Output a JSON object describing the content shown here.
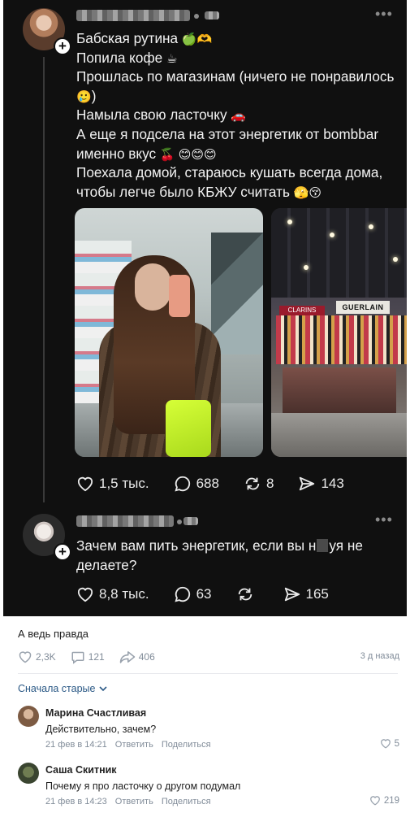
{
  "post": {
    "lines": [
      "Бабская рутина",
      "Попила кофе",
      "Прошлась по магазинам (ничего не понравилось",
      ")",
      "Намыла свою ласточку",
      "А еще я подсела на этот энергетик от bombbar",
      "именно вкус",
      "Поехала домой, стараюсь кушать всегда дома,",
      "чтобы легче было КБЖУ считать"
    ],
    "emoji": {
      "line1": "🍏🫶",
      "line2": "☕",
      "line3": "🥲",
      "line5": "🚗",
      "line7": "🍒 😊😊😊",
      "line9": "🫣😚"
    },
    "photo2_sign_left": "CLARINS",
    "photo2_sign_right": "GUERLAIN",
    "actions": {
      "likes": "1,5 тыс.",
      "comments": "688",
      "reposts": "8",
      "shares": "143"
    }
  },
  "reply": {
    "text_before": "Зачем вам пить энергетик, если вы н",
    "text_after": "уя не",
    "line2": "делаете?",
    "actions": {
      "likes": "8,8 тыс.",
      "comments": "63",
      "reposts": "",
      "shares": "165"
    }
  },
  "caption": "А ведь правда",
  "stats": {
    "likes": "2,3K",
    "comments": "121",
    "shares": "406",
    "time": "3 д назад"
  },
  "sort_label": "Сначала старые",
  "comments": [
    {
      "name": "Марина Счастливая",
      "text": "Действительно, зачем?",
      "date": "21 фев в 14:21",
      "reply": "Ответить",
      "share": "Поделиться",
      "likes": "5"
    },
    {
      "name": "Саша Скитник",
      "text": "Почему я про ласточку о другом подумал",
      "date": "21 фев в 14:23",
      "reply": "Ответить",
      "share": "Поделиться",
      "likes": "219"
    }
  ],
  "colors": {
    "dark_bg": "#101010",
    "link": "#2a5885",
    "meta": "#818c99"
  }
}
